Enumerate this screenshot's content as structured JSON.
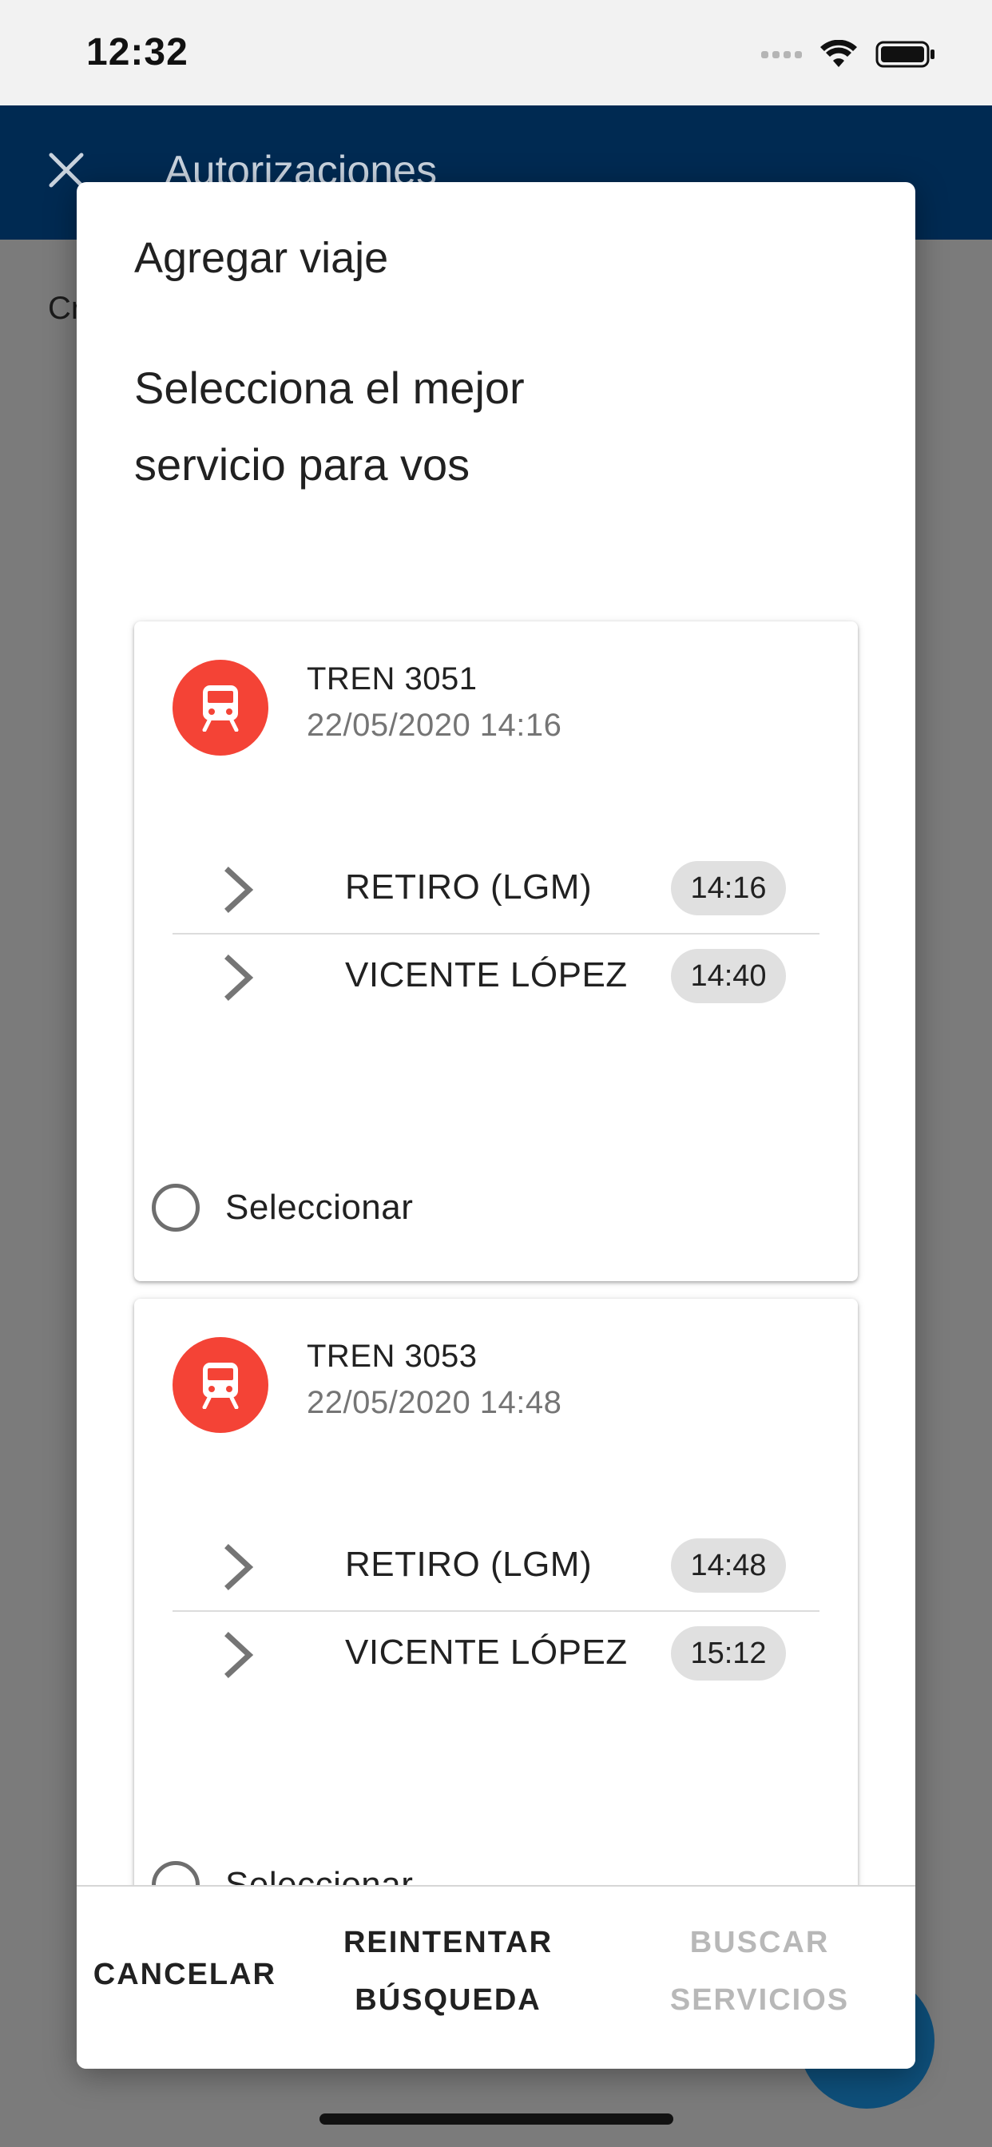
{
  "status_bar": {
    "time": "12:32"
  },
  "app_bar": {
    "title": "Autorizaciones"
  },
  "background": {
    "text_fragment": "Cr"
  },
  "dialog": {
    "title": "Agregar viaje",
    "subtitle": "Selecciona el mejor servicio para vos",
    "services": [
      {
        "name": "TREN 3051",
        "datetime": "22/05/2020 14:16",
        "stops": [
          {
            "name": "RETIRO (LGM)",
            "time": "14:16"
          },
          {
            "name": "VICENTE LÓPEZ",
            "time": "14:40"
          }
        ],
        "select_label": "Seleccionar"
      },
      {
        "name": "TREN 3053",
        "datetime": "22/05/2020 14:48",
        "stops": [
          {
            "name": "RETIRO (LGM)",
            "time": "14:48"
          },
          {
            "name": "VICENTE LÓPEZ",
            "time": "15:12"
          }
        ],
        "select_label": "Seleccionar"
      }
    ],
    "actions": {
      "cancel": "CANCELAR",
      "retry_line1": "REINTENTAR",
      "retry_line2": "BÚSQUEDA",
      "search_line1": "BUSCAR",
      "search_line2": "SERVICIOS"
    }
  },
  "colors": {
    "app_bar": "#002a52",
    "train_avatar": "#f44336",
    "chip": "#e0e0e0",
    "disabled_text": "#b8b8b8",
    "scrim": "#7a7a7a"
  },
  "icons": {
    "close": "close-icon",
    "train": "train-icon",
    "chevron": "chevron-right-icon",
    "wifi": "wifi-icon",
    "battery": "battery-icon",
    "signal": "signal-icon"
  }
}
